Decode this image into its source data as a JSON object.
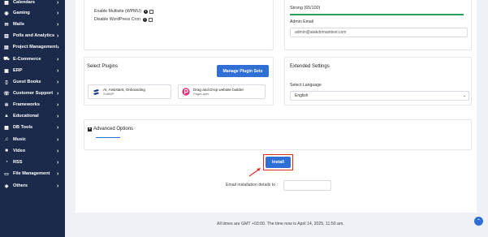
{
  "sidebar": {
    "items": [
      {
        "label": "Calendars",
        "icon": "calendar-icon"
      },
      {
        "label": "Gaming",
        "icon": "gamepad-icon"
      },
      {
        "label": "Mails",
        "icon": "mail-icon"
      },
      {
        "label": "Polls and Analytics",
        "icon": "chart-icon"
      },
      {
        "label": "Project Management",
        "icon": "briefcase-icon"
      },
      {
        "label": "E-Commerce",
        "icon": "cart-icon"
      },
      {
        "label": "ERP",
        "icon": "erp-icon"
      },
      {
        "label": "Guest Books",
        "icon": "book-icon"
      },
      {
        "label": "Customer Support",
        "icon": "support-icon"
      },
      {
        "label": "Frameworks",
        "icon": "gears-icon"
      },
      {
        "label": "Educational",
        "icon": "graduation-cap-icon"
      },
      {
        "label": "DB Tools",
        "icon": "database-icon"
      },
      {
        "label": "Music",
        "icon": "music-icon"
      },
      {
        "label": "Video",
        "icon": "video-icon"
      },
      {
        "label": "RSS",
        "icon": "rss-icon"
      },
      {
        "label": "File Management",
        "icon": "folder-icon"
      },
      {
        "label": "Others",
        "icon": "others-icon"
      }
    ]
  },
  "top_left": {
    "multisite_label": "Enable Multisite (WPMU)",
    "disable_cron_label": "Disable WordPress Cron"
  },
  "top_right": {
    "strength_text": "Strong (65/100)",
    "admin_email_label": "Admin Email",
    "admin_email_value": "admin@atakdomaintest.com"
  },
  "plugins": {
    "title": "Select Plugins",
    "manage_button": "Manage Plugin Sets",
    "items": [
      {
        "name": "AI, Assistant, Onboarding",
        "author": "SoftWP",
        "logo_color": "#1e3a8a"
      },
      {
        "name": "Drag and Drop website builder",
        "author": "PageLayer",
        "logo_color": "#e0307a"
      }
    ]
  },
  "extended": {
    "title": "Extended Settings",
    "language_label": "Select Language",
    "language_value": "English"
  },
  "advanced": {
    "title": "Advanced Options"
  },
  "install": {
    "button_label": "Install",
    "email_label": "Email installation details to :"
  },
  "footer": {
    "timestamp": "All times are GMT +03:00. The time now is April 14, 2025, 11:50 am."
  },
  "colors": {
    "sidebar_bg": "#1b2a4a",
    "accent": "#2f6fd6",
    "highlight": "#d62c2c",
    "strength": "#2f9e5a"
  }
}
